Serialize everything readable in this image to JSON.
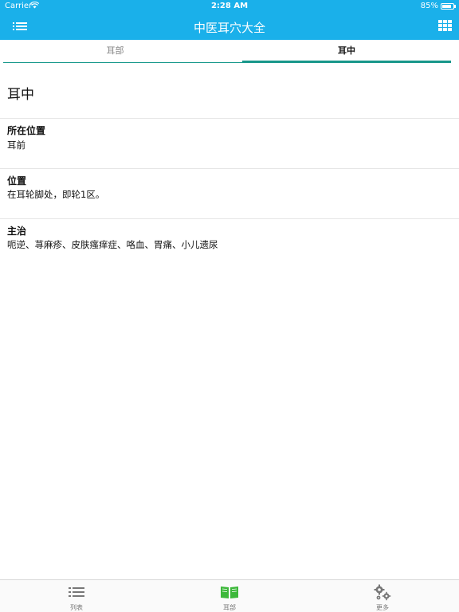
{
  "status_bar": {
    "carrier": "Carrier",
    "time": "2:28 AM",
    "battery_pct": "85%"
  },
  "nav": {
    "title": "中医耳穴大全"
  },
  "tabs": [
    {
      "label": "耳部"
    },
    {
      "label": "耳中"
    }
  ],
  "detail": {
    "heading": "耳中",
    "sections": [
      {
        "title": "所在位置",
        "body": "耳前"
      },
      {
        "title": "位置",
        "body": "在耳轮脚处，即轮1区。"
      },
      {
        "title": "主治",
        "body": "呃逆、荨麻疹、皮肤瘙痒症、咯血、胃痛、小儿遗尿"
      }
    ]
  },
  "tabbar": [
    {
      "label": "列表",
      "icon": "list-icon"
    },
    {
      "label": "耳部",
      "icon": "book-icon"
    },
    {
      "label": "更多",
      "icon": "gear-icon"
    }
  ],
  "colors": {
    "nav_background": "#1ab0ea",
    "tab_indicator": "#18978a",
    "active_tab_icon": "#3cb83a"
  }
}
